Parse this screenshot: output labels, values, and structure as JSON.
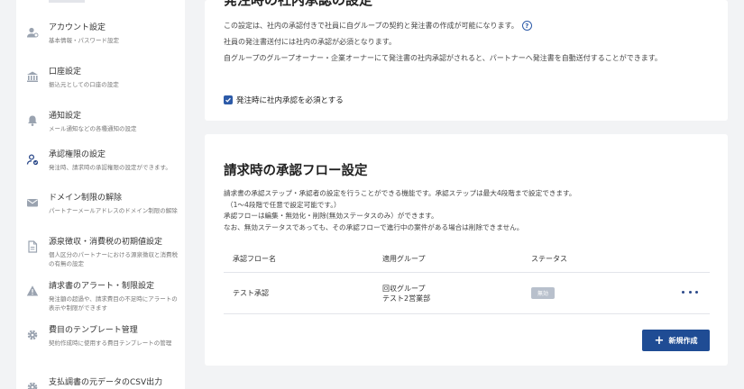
{
  "sidebar": {
    "items": [
      {
        "label": "アカウント設定",
        "desc": "基本情報・パスワード設定",
        "icon": "account-icon"
      },
      {
        "label": "口座設定",
        "desc": "振込元としての口座の設定",
        "icon": "bank-icon"
      },
      {
        "label": "通知設定",
        "desc": "メール通知などの各種通知の設定",
        "icon": "bell-icon"
      },
      {
        "label": "承認権限の設定",
        "desc": "発注時、請求時の承認権限の設定ができます。",
        "icon": "user-check-icon"
      },
      {
        "label": "ドメイン制限の解除",
        "desc": "パートナーメールアドレスのドメイン制限の解除",
        "icon": "mail-icon"
      },
      {
        "label": "源泉徴収・消費税の初期値設定",
        "desc": "個人区分のパートナーにおける源泉徴収と消費税の有無の設定",
        "icon": "document-icon"
      },
      {
        "label": "請求書のアラート・制限設定",
        "desc": "発注額の超過や、請求費目の不足時にアラートの表示や制限ができます",
        "icon": "warning-icon"
      },
      {
        "label": "費目のテンプレート管理",
        "desc": "契約作成時に使用する費目テンプレートの管理",
        "icon": "gear-icon"
      },
      {
        "label": "支払調書の元データのCSV出力",
        "desc": "",
        "icon": "gear-icon"
      }
    ]
  },
  "order_card": {
    "title": "発注時の社内承認の設定",
    "line1": "この設定は、社内の承認付きで社員に自グループの契約と発注書の作成が可能になります。",
    "line2": "社員の発注書送付には社内の承認が必須となります。",
    "line3": "自グループのグループオーナー・企業オーナーにて発注書の社内承認がされると、パートナーへ発注書を自動送付することができます。",
    "checkbox_label": "発注時に社内承認を必須とする",
    "checkbox_checked": true
  },
  "invoice_card": {
    "title": "請求時の承認フロー設定",
    "desc_lines": [
      "請求書の承認ステップ・承認者の設定を行うことができる機能です。承認ステップは最大4段階まで設定できます。",
      "（1〜4段階で任意で設定可能です。）",
      "承認フローは編集・無効化・削除(無効ステータスのみ）ができます。",
      "なお、無効ステータスであっても、その承認フローで進行中の案件がある場合は削除できません。"
    ],
    "table": {
      "headers": [
        "承認フロー名",
        "適用グループ",
        "ステータス"
      ],
      "rows": [
        {
          "name": "テスト承認",
          "groups": [
            "回収グループ",
            "テスト2営業部"
          ],
          "status": "無効"
        }
      ]
    },
    "new_button": "新規作成"
  },
  "colors": {
    "accent": "#1f4c94",
    "checkbox": "#2c5aa8",
    "status_disabled": "#b8c0cc",
    "background": "#f2f3f5"
  }
}
